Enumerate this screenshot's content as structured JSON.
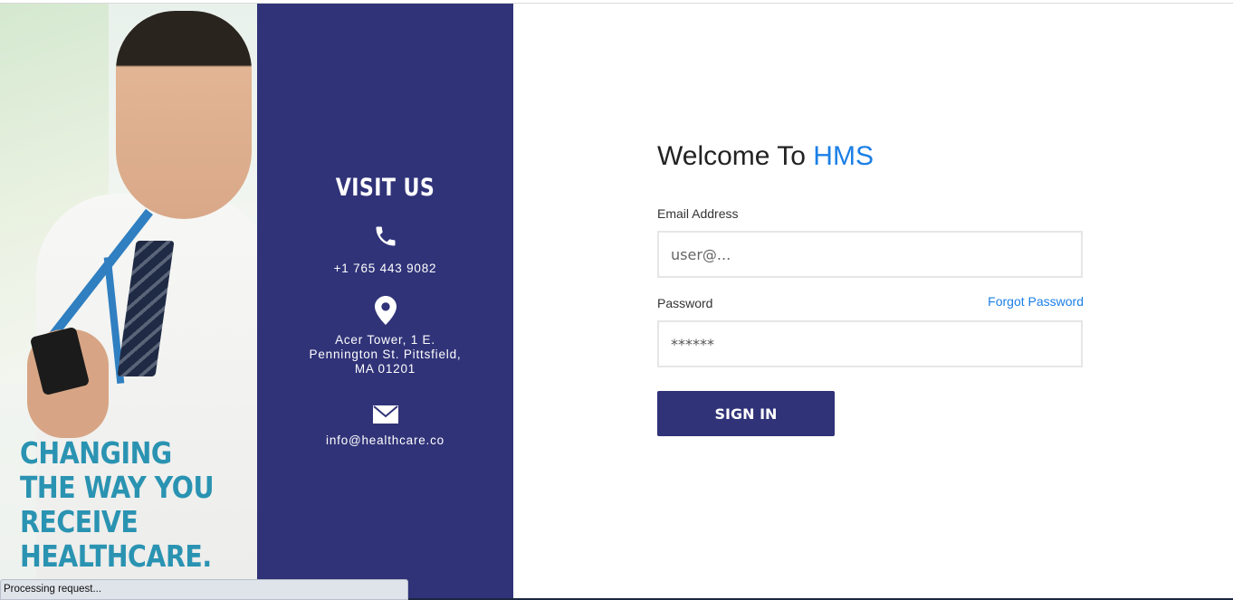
{
  "hero": {
    "tagline": [
      "CHANGING",
      "THE WAY YOU",
      "RECEIVE",
      "HEALTHCARE."
    ]
  },
  "visit": {
    "title": "VISIT US",
    "phone": "+1 765 443 9082",
    "address": [
      "Acer Tower, 1 E.",
      "Pennington St. Pittsfield,",
      "MA 01201"
    ],
    "email": "info@healthcare.co",
    "icons": [
      "phone-icon",
      "location-pin-icon",
      "envelope-icon"
    ]
  },
  "login": {
    "welcome_prefix": "Welcome To ",
    "welcome_brand": "HMS",
    "email_label": "Email Address",
    "email_placeholder": "user@...",
    "password_label": "Password",
    "forgot_password": "Forgot Password",
    "password_value": "******",
    "signin_label": "SIGN IN"
  },
  "status": {
    "text": "Processing request..."
  },
  "colors": {
    "panel": "#303378",
    "accent_blue": "#1b7fe6",
    "tagline": "#2a93b2"
  }
}
